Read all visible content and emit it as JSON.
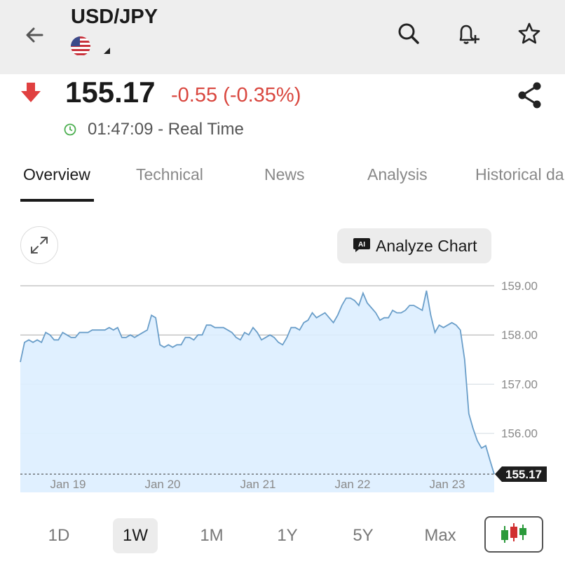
{
  "header": {
    "title": "USD/JPY",
    "back_icon": "arrow-left-icon",
    "flag_icon": "us-flag-icon",
    "actions": [
      "search-icon",
      "add-alert-icon",
      "star-icon"
    ]
  },
  "quote": {
    "price": "155.17",
    "change": "-0.55 (-0.35%)",
    "time": "01:47:09 - Real Time",
    "direction": "down",
    "change_color": "#d9473f",
    "status_color": "#4caf50"
  },
  "tabs": [
    "Overview",
    "Technical",
    "News",
    "Analysis",
    "Historical da"
  ],
  "active_tab": "Overview",
  "analyze_button": "Analyze Chart",
  "analyze_badge": "AI",
  "ranges": [
    "1D",
    "1W",
    "1M",
    "1Y",
    "5Y",
    "Max"
  ],
  "active_range": "1W",
  "chart_data": {
    "type": "area",
    "x_labels": [
      "Jan 19",
      "Jan 20",
      "Jan 21",
      "Jan 22",
      "Jan 23"
    ],
    "y_ticks": [
      "159.00",
      "158.00",
      "157.00",
      "156.00"
    ],
    "ylim": [
      154.8,
      159.0
    ],
    "current_value_label": "155.17",
    "current_value": 155.17,
    "line_color": "#6a9ec9",
    "fill_color": "#ddeeff",
    "values": [
      157.45,
      157.85,
      157.9,
      157.85,
      157.9,
      157.85,
      158.05,
      158.0,
      157.9,
      157.9,
      158.05,
      158.0,
      157.95,
      157.95,
      158.05,
      158.05,
      158.05,
      158.1,
      158.1,
      158.1,
      158.1,
      158.15,
      158.1,
      158.15,
      157.95,
      157.95,
      158.0,
      157.95,
      158.0,
      158.05,
      158.1,
      158.4,
      158.35,
      157.8,
      157.75,
      157.8,
      157.75,
      157.8,
      157.8,
      157.95,
      157.95,
      157.9,
      158.0,
      158.0,
      158.2,
      158.2,
      158.15,
      158.15,
      158.15,
      158.1,
      158.05,
      157.95,
      157.9,
      158.05,
      158.0,
      158.15,
      158.05,
      157.9,
      157.95,
      158.0,
      157.95,
      157.85,
      157.8,
      157.95,
      158.15,
      158.15,
      158.1,
      158.25,
      158.3,
      158.45,
      158.35,
      158.4,
      158.45,
      158.35,
      158.25,
      158.4,
      158.6,
      158.75,
      158.75,
      158.7,
      158.6,
      158.85,
      158.65,
      158.55,
      158.45,
      158.3,
      158.35,
      158.35,
      158.5,
      158.45,
      158.45,
      158.5,
      158.6,
      158.6,
      158.55,
      158.5,
      158.9,
      158.4,
      158.05,
      158.2,
      158.15,
      158.2,
      158.25,
      158.2,
      158.1,
      157.5,
      156.4,
      156.1,
      155.85,
      155.7,
      155.75,
      155.45,
      155.17
    ]
  }
}
